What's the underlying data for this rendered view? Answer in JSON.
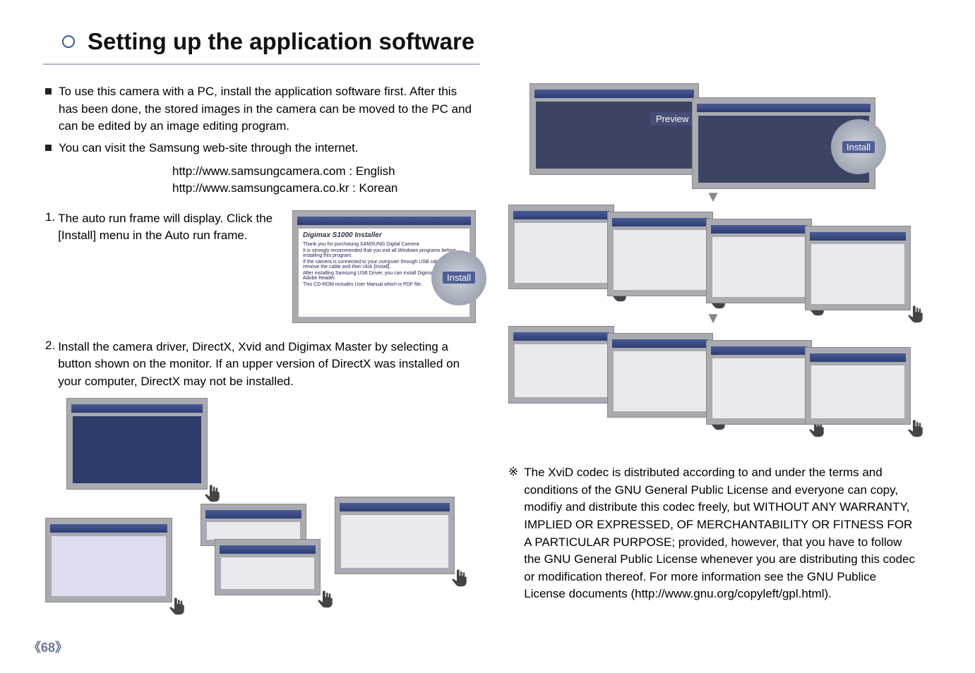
{
  "page_title": "Setting up the application software",
  "page_number_display": "《68》",
  "bullet1": "To use this camera with a PC, install the application software first. After this has been done, the stored images in the camera can be moved to the PC and can be edited by an image editing program.",
  "bullet2": "You can visit the Samsung web-site through the internet.",
  "url_en": "http://www.samsungcamera.com : English",
  "url_kr": "http://www.samsungcamera.co.kr : Korean",
  "step1_num": "1.",
  "step1_text": "The auto run frame will display. Click the [Install] menu in the Auto run frame.",
  "step2_num": "2.",
  "step2_text": "Install the camera driver, DirectX, Xvid and Digimax Master by selecting a button shown on the monitor. If an upper version of DirectX was installed on your computer, DirectX may not be installed.",
  "note_marker": "※",
  "note_text": "The XviD codec is distributed according to and under the terms and conditions of the GNU General Public License and everyone can copy, modifiy and distribute this codec freely, but WITHOUT ANY WARRANTY, IMPLIED OR EXPRESSED, OF MERCHANTABILITY OR FITNESS FOR A PARTICULAR PURPOSE; provided, however, that you have to follow the GNU General Public License whenever you are distributing this codec or modification thereof. For more information see the GNU Publice License documents (http://www.gnu.org/copyleft/gpl.html).",
  "install_label": "Install",
  "preview_label": "Preview",
  "installer_title": "Digimax S1000 Installer",
  "installer_bullets": [
    "Thank you for purchasing SAMSUNG Digital Camera",
    "It is strongly recommended that you exit all Windows programs before installing this program.",
    "If the camera is connected to your computer through USB cable, please remove the cable and then click [Install].",
    "After installing Samsung USB Driver, you can install Digimax Master and Adobe Reader.",
    "This CD-ROM includes User Manual which is PDF file."
  ]
}
